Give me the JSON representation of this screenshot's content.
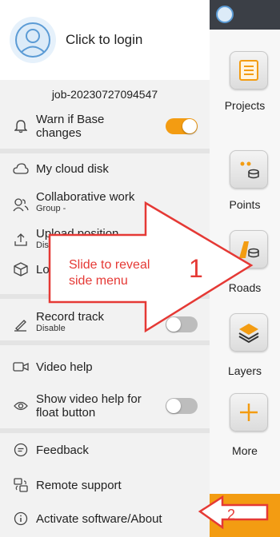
{
  "header": {
    "login_label": "Click to login",
    "job_name": "job-20230727094547"
  },
  "menu": {
    "warn_base_label": "Warn if Base changes",
    "cloud_disk": "My cloud disk",
    "collab_label": "Collaborative work",
    "collab_sub": "Group -",
    "upload_label": "Upload position",
    "upload_sub": "Dis",
    "lo_label": "Lo",
    "record_label": "Record track",
    "record_sub": "Disable",
    "video_help": "Video help",
    "show_video_label": "Show video help for float button",
    "feedback": "Feedback",
    "remote_support": "Remote support",
    "activate": "Activate software/About"
  },
  "toggles": {
    "warn_base_on": true,
    "record_track_on": false,
    "show_video_on": false
  },
  "sidebar": {
    "projects": "Projects",
    "points": "Points",
    "roads": "Roads",
    "layers": "Layers",
    "more": "More"
  },
  "annotation": {
    "instruction": "Slide to reveal side menu",
    "step1": "1",
    "step2": "2"
  },
  "colors": {
    "accent": "#f39c12",
    "annotation": "#e53935",
    "toggle_off": "#bdbdbd"
  }
}
